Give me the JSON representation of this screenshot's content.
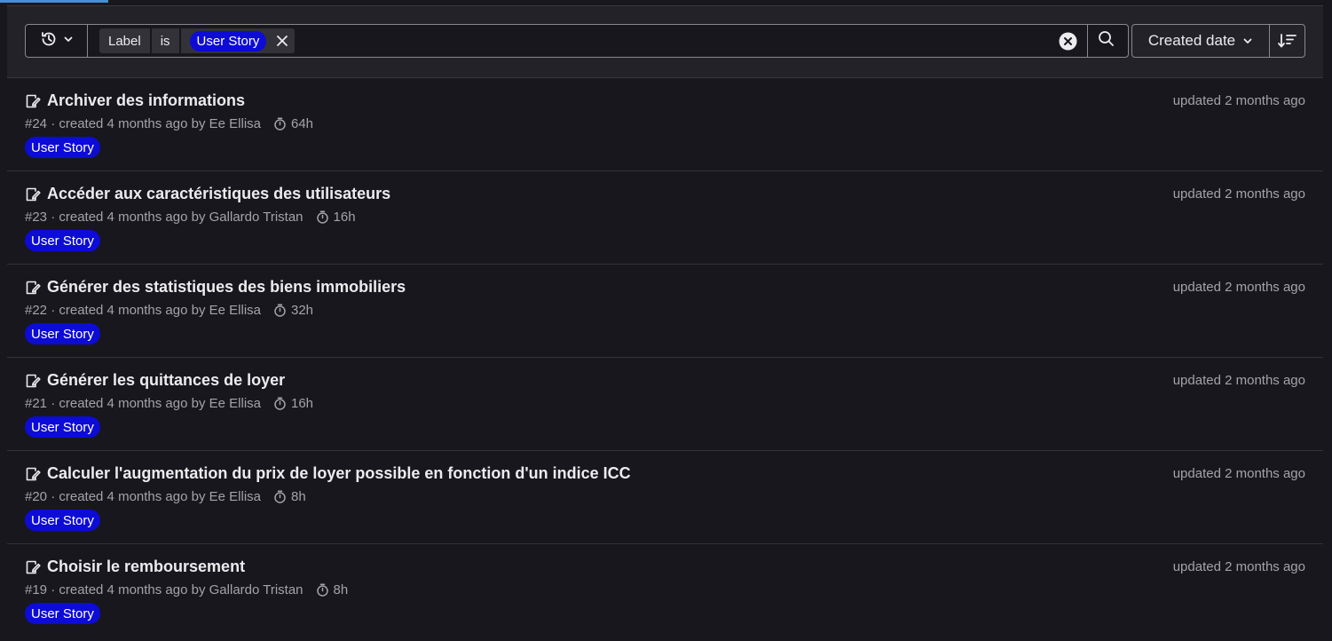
{
  "filter": {
    "token_key": "Label",
    "token_operator": "is",
    "token_value": "User Story"
  },
  "sort": {
    "label": "Created date"
  },
  "colors": {
    "background": "#18171d",
    "filter_bar": "#232228",
    "label_user_story": "#0d0bd6",
    "accent": "#428fdc"
  },
  "icons": {
    "history": "history-icon",
    "chevron": "chevron-down-icon",
    "clear": "clear-icon",
    "search": "search-icon",
    "sort_direction": "sort-lowest-icon",
    "issue_type": "issue-type-icon",
    "timer": "timer-icon"
  },
  "issues": [
    {
      "title": "Archiver des informations",
      "ref": "#24",
      "created": " · created 4 months ago by ",
      "author": "Ee Ellisa",
      "estimate": "64h",
      "label": "User Story",
      "updated": "updated 2 months ago"
    },
    {
      "title": "Accéder aux caractéristiques des utilisateurs",
      "ref": "#23",
      "created": " · created 4 months ago by ",
      "author": "Gallardo Tristan",
      "estimate": "16h",
      "label": "User Story",
      "updated": "updated 2 months ago"
    },
    {
      "title": "Générer des statistiques des biens immobiliers",
      "ref": "#22",
      "created": " · created 4 months ago by ",
      "author": "Ee Ellisa",
      "estimate": "32h",
      "label": "User Story",
      "updated": "updated 2 months ago"
    },
    {
      "title": "Générer les quittances de loyer",
      "ref": "#21",
      "created": " · created 4 months ago by ",
      "author": "Ee Ellisa",
      "estimate": "16h",
      "label": "User Story",
      "updated": "updated 2 months ago"
    },
    {
      "title": "Calculer l'augmentation du prix de loyer possible en fonction d'un indice ICC",
      "ref": "#20",
      "created": " · created 4 months ago by ",
      "author": "Ee Ellisa",
      "estimate": "8h",
      "label": "User Story",
      "updated": "updated 2 months ago"
    },
    {
      "title": "Choisir le remboursement",
      "ref": "#19",
      "created": " · created 4 months ago by ",
      "author": "Gallardo Tristan",
      "estimate": "8h",
      "label": "User Story",
      "updated": "updated 2 months ago"
    }
  ]
}
